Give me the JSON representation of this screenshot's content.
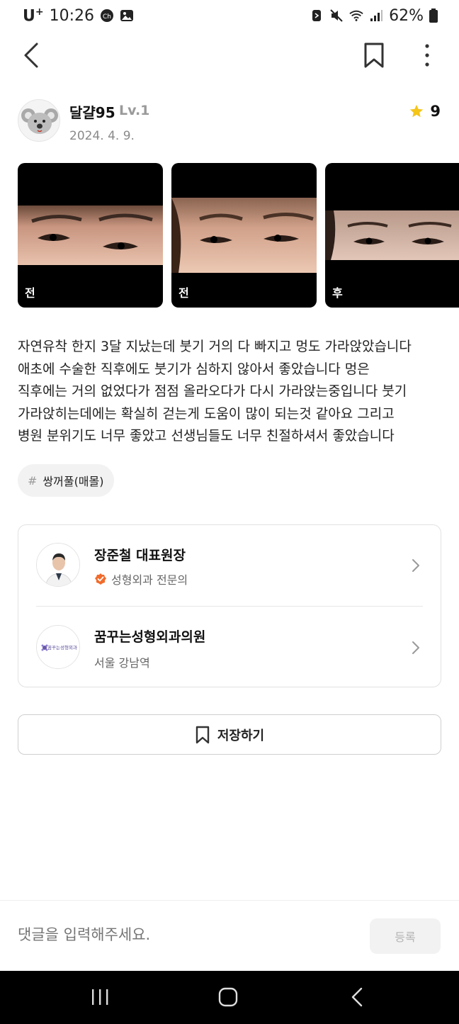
{
  "status_bar": {
    "carrier": "U",
    "carrier_sup": "+",
    "time": "10:26",
    "battery": "62%"
  },
  "header": {
    "back_icon": "chevron-left-icon",
    "bookmark_icon": "bookmark-icon",
    "more_icon": "more-vertical-icon"
  },
  "author": {
    "name": "달걀95",
    "level": "Lv.1",
    "date": "2024. 4. 9.",
    "rating": "9"
  },
  "photos": [
    {
      "label": "전"
    },
    {
      "label": "전"
    },
    {
      "label": "후"
    }
  ],
  "post": {
    "lines": [
      "자연유착 한지 3달 지났는데 붓기 거의 다 빠지고 멍도 가라앉았습니다",
      "애초에 수술한 직후에도 붓기가 심하지 않아서 좋았습니다 멍은",
      "직후에는 거의 없었다가 점점 올라오다가 다시 가라앉는중입니다 붓기",
      "가라앉히는데에는 확실히 걷는게 도움이 많이 되는것 같아요 그리고",
      "병원 분위기도 너무 좋았고 선생님들도 너무 친절하셔서 좋았습니다"
    ]
  },
  "tag": {
    "hash": "#",
    "text": "쌍꺼풀(매몰)"
  },
  "doctor": {
    "name": "장준철 대표원장",
    "specialty": "성형외과 전문의"
  },
  "clinic": {
    "name": "꿈꾸는성형외과의원",
    "location": "서울 강남역",
    "logo_text": "꿈꾸는성형외과"
  },
  "save_button": {
    "label": "저장하기"
  },
  "comment": {
    "placeholder": "댓글을 입력해주세요.",
    "submit_label": "등록"
  },
  "colors": {
    "star": "#f5c518",
    "verified": "#f26b2b",
    "nav_bg": "#000000"
  }
}
